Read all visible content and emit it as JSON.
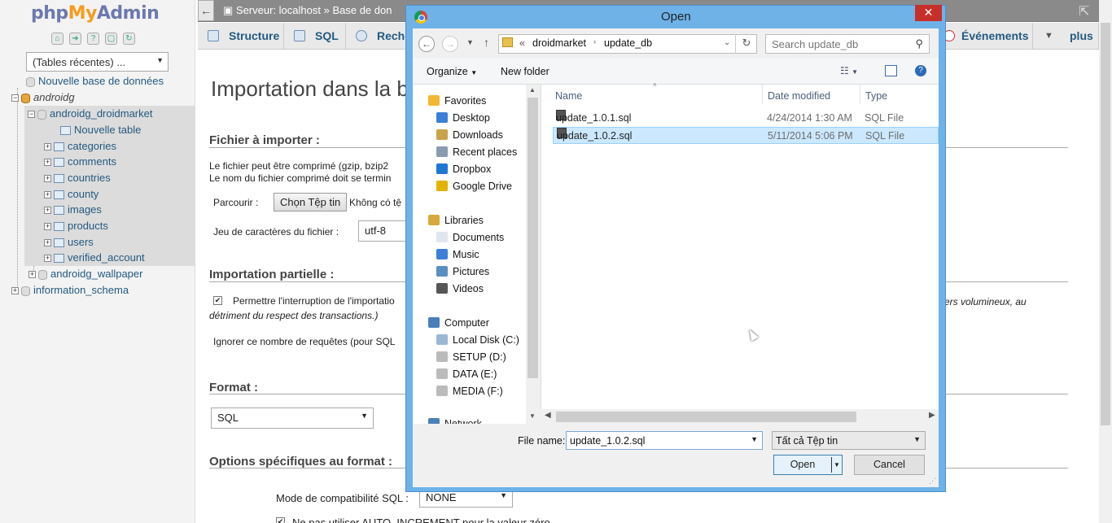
{
  "nav": {
    "logo": {
      "php": "php",
      "my": "My",
      "admin": "Admin"
    },
    "recent": "(Tables récentes) ...",
    "tree": {
      "new_db": "Nouvelle base de données",
      "androidg": "androidg",
      "droidmarket": "androidg_droidmarket",
      "new_table": "Nouvelle table",
      "tables": [
        "categories",
        "comments",
        "countries",
        "county",
        "images",
        "products",
        "users",
        "verified_account"
      ],
      "wallpaper": "androidg_wallpaper",
      "info_schema": "information_schema"
    }
  },
  "topbar": {
    "crumb_server": "Serveur: localhost",
    "crumb_sep": "»",
    "crumb_db": "Base de don"
  },
  "tabs": {
    "structure": "Structure",
    "sql": "SQL",
    "search": "Reche",
    "events": "Événements",
    "more": "plus"
  },
  "main": {
    "title": "Importation dans la b",
    "file_section": "Fichier à importer :",
    "file_line1": "Le fichier peut être comprimé (gzip, bzip2",
    "file_line2": "Le nom du fichier comprimé doit se termin",
    "browse_label": "Parcourir :",
    "choose_file": "Chọn Tệp tin",
    "no_file": "Không có tệ",
    "charset_label": "Jeu de caractères du fichier :",
    "charset_value": "utf-8",
    "partial_section": "Importation partielle :",
    "interrupt_text": "Permettre l'interruption de l'importatio",
    "interrupt_right": "ers volumineux, au",
    "interrupt_line2": "détriment du respect des transactions.)",
    "skip_label": "Ignorer ce nombre de requêtes (pour SQL",
    "format_section": "Format :",
    "format_value": "SQL",
    "options_section": "Options spécifiques au format :",
    "compat_label": "Mode de compatibilité SQL :",
    "compat_value": "NONE",
    "auto_inc_text": "Ne pas utiliser AUTO_INCREMENT pour la valeur zéro"
  },
  "dialog": {
    "title": "Open",
    "path": [
      "«",
      "droidmarket",
      "update_db"
    ],
    "search_placeholder": "Search update_db",
    "organize": "Organize",
    "new_folder": "New folder",
    "sidebar": {
      "favorites": "Favorites",
      "fav_items": [
        "Desktop",
        "Downloads",
        "Recent places",
        "Dropbox",
        "Google Drive"
      ],
      "libraries": "Libraries",
      "lib_items": [
        "Documents",
        "Music",
        "Pictures",
        "Videos"
      ],
      "computer": "Computer",
      "drives": [
        "Local Disk (C:)",
        "SETUP (D:)",
        "DATA (E:)",
        "MEDIA (F:)"
      ],
      "network": "Network"
    },
    "columns": {
      "name": "Name",
      "date": "Date modified",
      "type": "Type"
    },
    "files": [
      {
        "name": "update_1.0.1.sql",
        "date": "4/24/2014 1:30 AM",
        "type": "SQL File"
      },
      {
        "name": "update_1.0.2.sql",
        "date": "5/11/2014 5:06 PM",
        "type": "SQL File"
      }
    ],
    "filename_label": "File name:",
    "filename_value": "update_1.0.2.sql",
    "filetype_value": "Tất cả Tệp tin",
    "open": "Open",
    "cancel": "Cancel"
  },
  "colors": {
    "pma_link": "#235a81",
    "dialog_frame": "#6eb2e8",
    "close_red": "#c7302a",
    "selected_row": "#cce8ff"
  }
}
